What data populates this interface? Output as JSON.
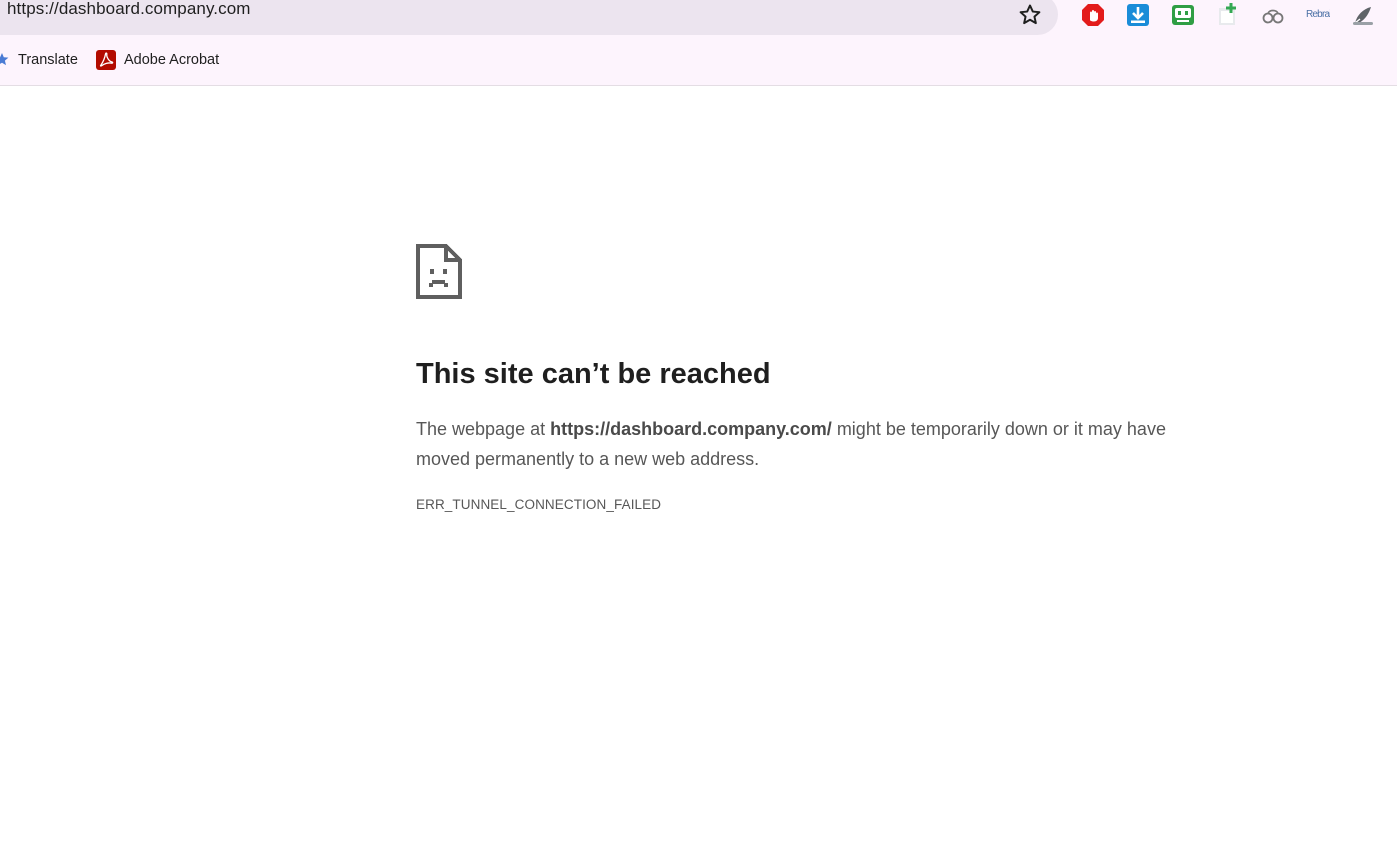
{
  "browser": {
    "address_bar": {
      "url": "https://dashboard.company.com"
    },
    "bookmarks": [
      {
        "label": "Translate",
        "icon": "translate-icon"
      },
      {
        "label": "Adobe Acrobat",
        "icon": "adobe-acrobat-icon"
      }
    ],
    "extensions": [
      {
        "name": "adblock-icon",
        "color": "#e31b1b"
      },
      {
        "name": "download-icon",
        "color": "#1a8cd8"
      },
      {
        "name": "robot-extension-icon",
        "color": "#2f9e44"
      },
      {
        "name": "add-extension-icon",
        "color": "#34a853"
      },
      {
        "name": "link-extension-icon",
        "color": "#777777"
      },
      {
        "name": "text-extension-icon",
        "color": "#4a6fa5"
      },
      {
        "name": "profile-extension-icon",
        "color": "#555555"
      }
    ],
    "extension_text": "Rebrain"
  },
  "error_page": {
    "title": "This site can’t be reached",
    "desc_prefix": "The webpage at ",
    "desc_url": "https://dashboard.company.com/",
    "desc_suffix": " might be temporarily down or it may have moved permanently to a new web address.",
    "error_code": "ERR_TUNNEL_CONNECTION_FAILED"
  }
}
